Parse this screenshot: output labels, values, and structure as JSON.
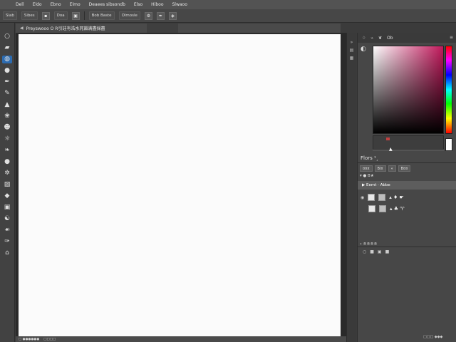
{
  "menubar": {
    "items": [
      "Dell",
      "Eldo",
      "Ebno",
      "Elmo",
      "Deaees sibsondb",
      "Elso",
      "Hiboo",
      "Slwaoo"
    ]
  },
  "optbar": {
    "items": [
      "Slab",
      "Sibes",
      "Doa",
      "Bob Baste",
      "Olmosle"
    ]
  },
  "doctab": {
    "title": "Preyswooo O R引詿有浩水死豁满盡採盡"
  },
  "tools": [
    "○",
    "▰",
    "◍",
    "●",
    "✒",
    "✎",
    "▲",
    "❀",
    "☻",
    "☼",
    "❧",
    "●",
    "✲",
    "▨",
    "◆",
    "▣",
    "☯",
    "☙",
    "✑",
    "⌂"
  ],
  "status": {
    "left": "□ ●●●●●●",
    "mid": "□□□□"
  },
  "panel": {
    "tabs": [
      "♢",
      "⌁",
      "❦",
      "Ob"
    ],
    "section_title": "Flors ¹¸",
    "buttons": [
      "¤¤¤",
      "Bl¤",
      "«",
      "B¤¤"
    ],
    "opts": "▾  ●  B★",
    "highlight": "▶  Eemt  ·  Abbe",
    "rows": [
      {
        "label": "▴  ♦  ☛"
      },
      {
        "label": "▴  ♣  ♈"
      }
    ],
    "bottom_label": "• ®®®®",
    "bottom_icons": [
      "○",
      "■",
      "▣",
      "■"
    ],
    "status": "□□□ ◆◆◆"
  }
}
